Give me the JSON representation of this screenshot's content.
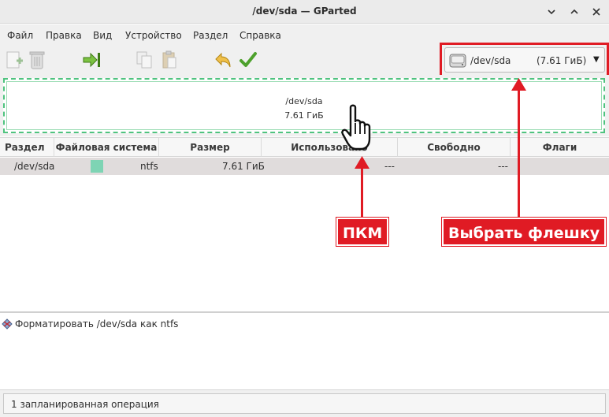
{
  "window": {
    "title": "/dev/sda — GParted"
  },
  "menu": [
    "Файл",
    "Правка",
    "Вид",
    "Устройство",
    "Раздел",
    "Справка"
  ],
  "toolbar_icons": [
    "new-partition-icon",
    "delete-icon",
    "resize-move-icon",
    "copy-icon",
    "paste-icon",
    "undo-icon",
    "apply-icon"
  ],
  "device": {
    "name": "/dev/sda",
    "size": "(7.61 ГиБ)"
  },
  "disk_graphic": {
    "name": "/dev/sda",
    "size": "7.61 ГиБ"
  },
  "table": {
    "headers": [
      "Раздел",
      "Файловая система",
      "Размер",
      "Использовано",
      "Свободно",
      "Флаги"
    ],
    "rows": [
      {
        "partition": "/dev/sda",
        "filesystem": "ntfs",
        "size": "7.61 ГиБ",
        "used": "---",
        "free": "---",
        "flags": ""
      }
    ]
  },
  "operations": [
    "Форматировать /dev/sda как ntfs"
  ],
  "status": "1 запланированная операция",
  "annotations": {
    "right_click": "ПКМ",
    "select_drive": "Выбрать флешку"
  },
  "colors": {
    "accent_red": "#e01b24",
    "ntfs": "#7ed4b4",
    "disk_border": "#4fc37f"
  }
}
